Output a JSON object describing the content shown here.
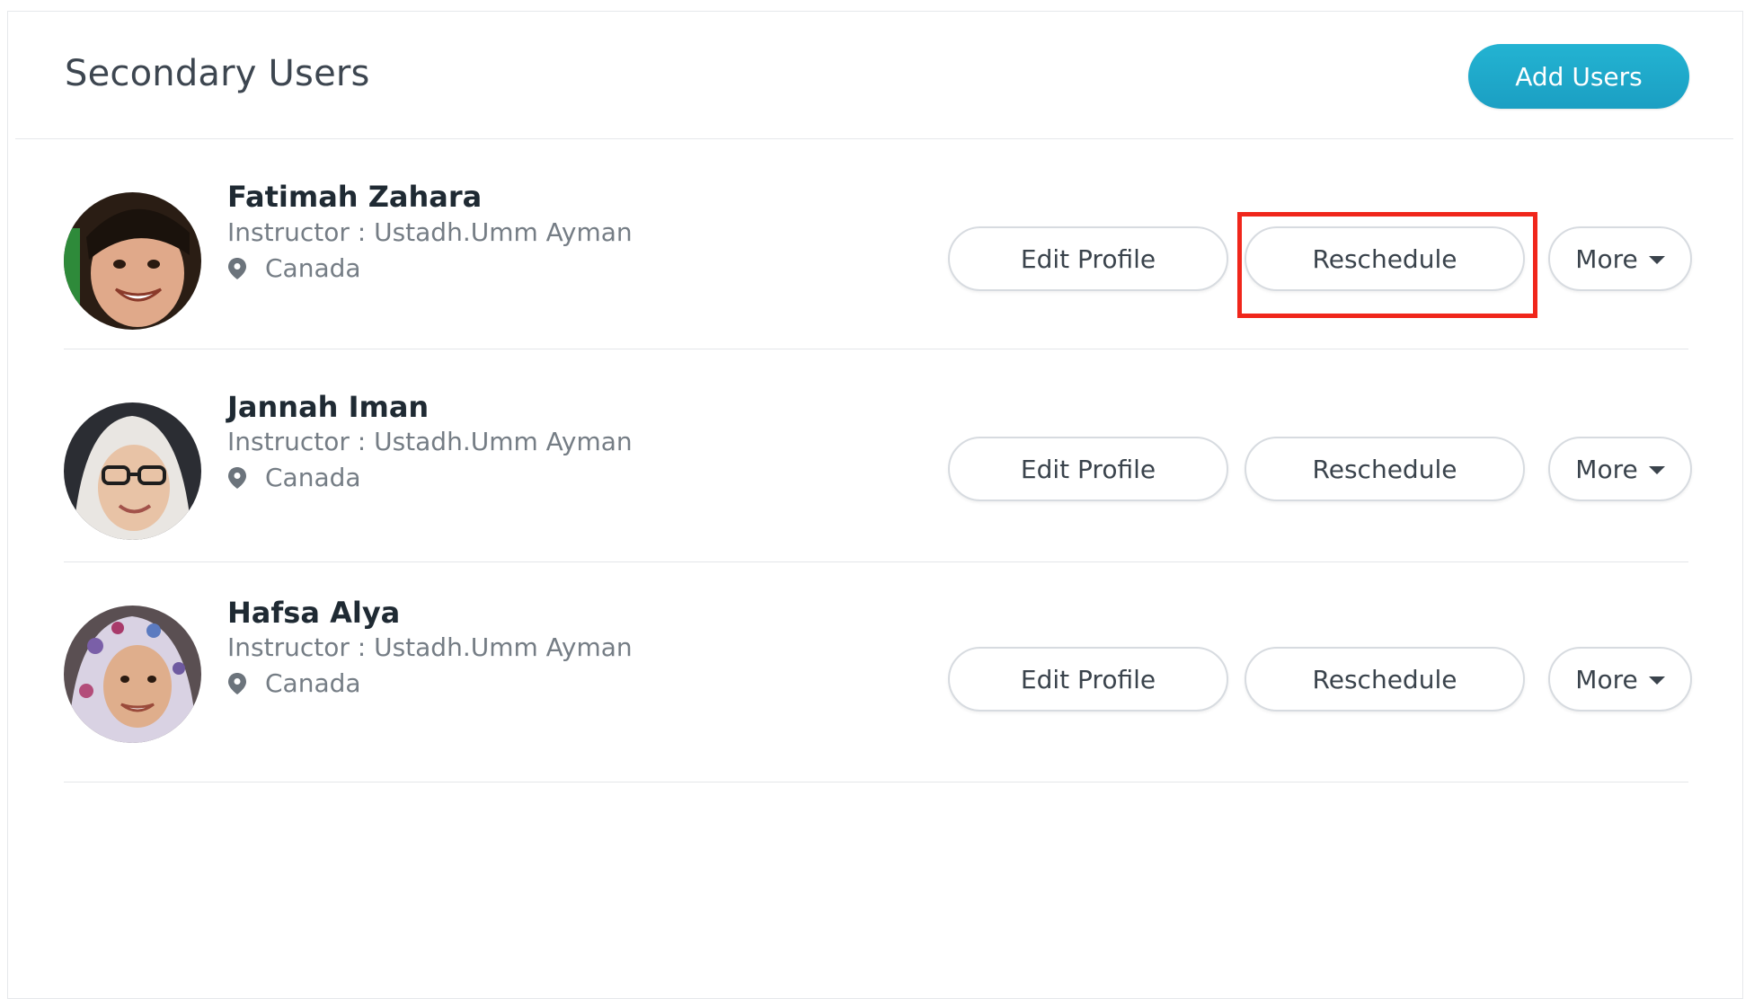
{
  "header": {
    "title": "Secondary Users",
    "add_users_label": "Add Users"
  },
  "users": [
    {
      "name": "Fatimah Zahara",
      "instructor": "Instructor : Ustadh.Umm Ayman",
      "location": "Canada",
      "edit_label": "Edit Profile",
      "reschedule_label": "Reschedule",
      "more_label": "More"
    },
    {
      "name": "Jannah Iman",
      "instructor": "Instructor : Ustadh.Umm Ayman",
      "location": "Canada",
      "edit_label": "Edit Profile",
      "reschedule_label": "Reschedule",
      "more_label": "More"
    },
    {
      "name": "Hafsa Alya",
      "instructor": "Instructor : Ustadh.Umm Ayman",
      "location": "Canada",
      "edit_label": "Edit Profile",
      "reschedule_label": "Reschedule",
      "more_label": "More"
    }
  ],
  "colors": {
    "accent": "#1ea9cb",
    "highlight": "#f0261b",
    "text_primary": "#1f2a33",
    "text_secondary": "#757d85"
  },
  "icons": {
    "location": "map-pin-icon",
    "more": "caret-down-icon"
  }
}
